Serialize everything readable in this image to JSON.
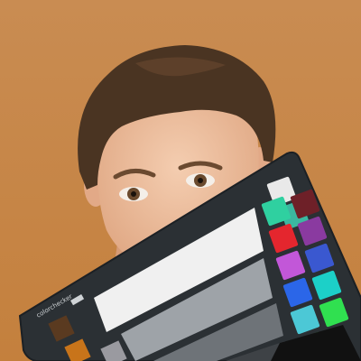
{
  "colors": {
    "background_top": "#c98c52",
    "background_bottom": "#c4803d",
    "skin": "#f0c4a2",
    "skin_shadow": "#d9a07c",
    "hair": "#4a3422",
    "hair_light": "#6b4a30",
    "card_body": "#2b3034",
    "card_edge": "#1c2024"
  },
  "color_card": {
    "brand_text": "colorchecker",
    "brand_badge": "",
    "neutral_patches": [
      "#f0f0f0",
      "#9ea3a8",
      "#6e7378",
      "#3e4246"
    ],
    "swatches": [
      "#e9e9e9",
      "#3bb7a0",
      "#2fd0a0",
      "#6e2028",
      "#e4262e",
      "#8a3aa0",
      "#c257d8",
      "#3a58d0",
      "#2b66e8",
      "#1cd0c8",
      "#4cc8d6",
      "#30e050",
      "#36d83e"
    ],
    "small_patches": [
      "#5a3a20",
      "#c8741a",
      "#9a9aa0"
    ]
  }
}
